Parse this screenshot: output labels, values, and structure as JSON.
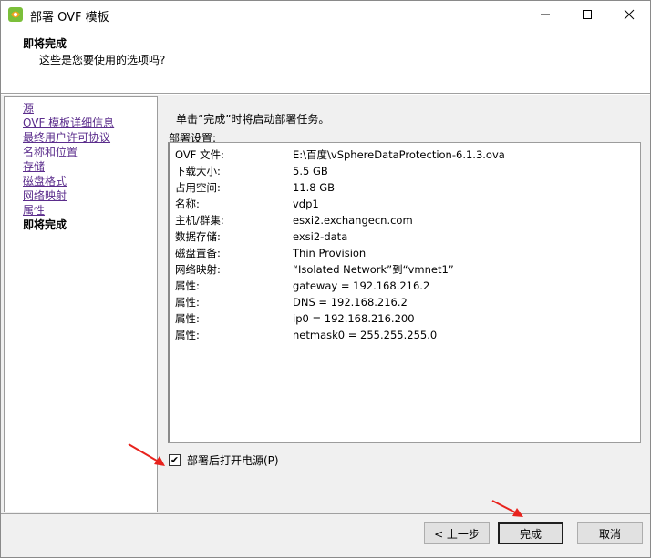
{
  "window": {
    "title": "部署 OVF 模板",
    "controls": {
      "minimize": "—",
      "maximize": "☐",
      "close": "✕"
    }
  },
  "header": {
    "title": "即将完成",
    "subtitle": "这些是您要使用的选项吗?"
  },
  "nav": {
    "items": [
      {
        "label": "源"
      },
      {
        "label": "OVF 模板详细信息"
      },
      {
        "label": "最终用户许可协议"
      },
      {
        "label": "名称和位置"
      },
      {
        "label": "存储"
      },
      {
        "label": "磁盘格式"
      },
      {
        "label": "网络映射"
      },
      {
        "label": "属性"
      },
      {
        "label": "即将完成"
      }
    ],
    "current_index": 8
  },
  "main": {
    "instruction": "单击“完成”时将启动部署任务。",
    "settings_label": "部署设置:",
    "settings": [
      {
        "key": "OVF 文件:",
        "value": "E:\\百度\\vSphereDataProtection-6.1.3.ova"
      },
      {
        "key": "下载大小:",
        "value": "5.5 GB"
      },
      {
        "key": "占用空间:",
        "value": "11.8 GB"
      },
      {
        "key": "名称:",
        "value": "vdp1"
      },
      {
        "key": "主机/群集:",
        "value": "esxi2.exchangecn.com"
      },
      {
        "key": "数据存储:",
        "value": "exsi2-data"
      },
      {
        "key": "磁盘置备:",
        "value": "Thin Provision"
      },
      {
        "key": "网络映射:",
        "value": "“Isolated Network”到“vmnet1”"
      },
      {
        "key": "属性:",
        "value": "gateway = 192.168.216.2"
      },
      {
        "key": "属性:",
        "value": "DNS = 192.168.216.2"
      },
      {
        "key": "属性:",
        "value": "ip0 = 192.168.216.200"
      },
      {
        "key": "属性:",
        "value": "netmask0 = 255.255.255.0"
      }
    ],
    "power_on": {
      "label": "部署后打开电源(P)",
      "checked": true,
      "check_glyph": "✔"
    }
  },
  "footer": {
    "back_label": "< 上一步",
    "finish_label": "完成",
    "cancel_label": "取消"
  },
  "colors": {
    "link": "#5b2d8c",
    "annotation_arrow": "#e8231d",
    "panel_bg": "#f0f0f0",
    "icon_green": "#7bbf3a",
    "icon_orange": "#f0a21f"
  },
  "icons": {
    "app": "vsphere-logo-icon",
    "arrow_annotation": "red-arrow-icon"
  }
}
